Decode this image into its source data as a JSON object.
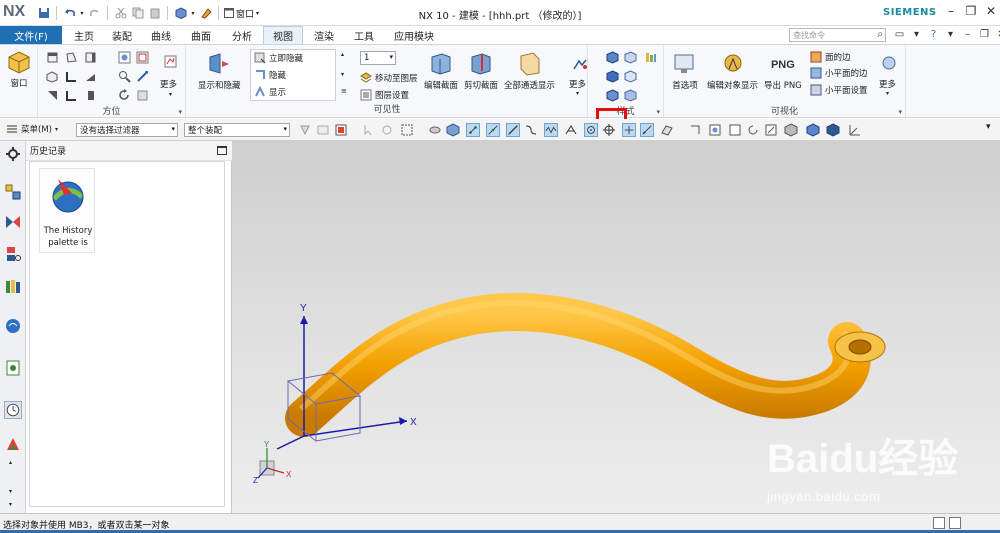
{
  "app": {
    "logo": "NX",
    "title": "NX 10 - 建模 - [hhh.prt （修改的）]",
    "brand": "SIEMENS",
    "window_menu": "窗口"
  },
  "menu": {
    "file": "文件(F)",
    "tabs": [
      "主页",
      "装配",
      "曲线",
      "曲面",
      "分析",
      "视图",
      "渲染",
      "工具",
      "应用模块"
    ],
    "active_tab": "视图",
    "search_placeholder": "查找命令"
  },
  "ribbon": {
    "window_btn": "窗口",
    "orientation_more": "更多",
    "orientation_label": "方位",
    "show_hide": "显示和隐藏",
    "immediate_hide": "立即隐藏",
    "hide": "隐藏",
    "show": "显示",
    "layer_value": "1",
    "move_to_layer": "移动至图层",
    "layer_settings": "图层设置",
    "edit_section": "编辑截面",
    "clip_section": "剪切截面",
    "show_all_through": "全部通透显示",
    "visibility_more": "更多",
    "visibility_label": "可见性",
    "style_label": "样式",
    "preferences": "首选项",
    "edit_object_display": "编辑对象显示",
    "export_png_icon_text": "PNG",
    "export_png": "导出 PNG",
    "face_edges": "面的边",
    "small_face_edges": "小平面的边",
    "small_face_settings": "小平面设置",
    "visualize_more": "更多",
    "visualize_label": "可视化"
  },
  "selection_bar": {
    "menu": "菜单(M)",
    "filter": "没有选择过滤器",
    "scope": "整个装配"
  },
  "history": {
    "title": "历史记录",
    "tile_text": "The History palette is"
  },
  "graphics": {
    "axis_x": "X",
    "axis_y": "Y",
    "axis_z": "Z",
    "watermark": "Baidu经验",
    "watermark_url": "jingyan.baidu.com",
    "tube_color": "#f2a000"
  },
  "status": {
    "message": "选择对象并使用 MB3，或者双击某一对象"
  },
  "colors": {
    "accent": "#1f6fb4",
    "highlight": "#e01010",
    "brand": "#1a8aa0"
  }
}
